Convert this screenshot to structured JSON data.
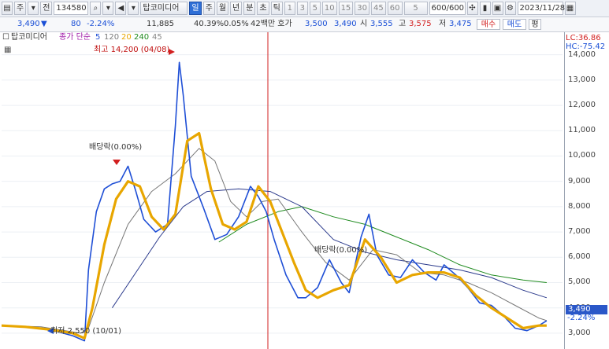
{
  "toolbar": {
    "market": "주",
    "pre": "전",
    "code": "134580",
    "name": "탑코미디어",
    "periods": [
      "일",
      "주",
      "월",
      "년",
      "분",
      "초",
      "틱"
    ],
    "active_period": "일",
    "numbers": [
      "1",
      "3",
      "5",
      "10",
      "15",
      "30",
      "45",
      "60"
    ],
    "interval": "5",
    "count": "600/600",
    "date": "2023/11/28"
  },
  "quote": {
    "price": "3,490",
    "change_arrow": "▼",
    "change": "80",
    "change_pct": "-2.24%",
    "volume": "11,885",
    "volume_ratio": "40.39%",
    "turnover": "0.05%",
    "quote_label": "42백만 호가",
    "ask": "3,500",
    "bid": "3,490",
    "open_label": "시",
    "open": "3,555",
    "high_label": "고",
    "high": "3,575",
    "low_label": "저",
    "low": "3,475",
    "buy_label": "매수",
    "sell_label": "매도",
    "avg_label": "평"
  },
  "legend": {
    "name": "탑코미디어",
    "ma_label": "종가 단순",
    "ma_periods": [
      "5",
      "120",
      "20",
      "240",
      "45"
    ],
    "ma_colors": [
      "#1f4fd6",
      "#7a7a7a",
      "#e8a600",
      "#1e8a1e",
      "#888888"
    ]
  },
  "axis": {
    "lc": "LC:36.86",
    "hc": "HC:-75.42",
    "ticks": [
      "14,000",
      "13,000",
      "12,000",
      "11,000",
      "10,000",
      "9,000",
      "8,000",
      "7,000",
      "6,000",
      "5,000",
      "4,000",
      "3,000"
    ],
    "current_price": "3,490",
    "current_change": "-2.24%"
  },
  "annotations": {
    "high": "최고 14,200 (04/08)",
    "low": "최저 2,550 (10/01)",
    "dividend1": "배당락(0.00%)",
    "dividend2": "배당락(0.00%)"
  },
  "chart_data": {
    "type": "line",
    "series": [
      {
        "name": "5",
        "color": "#1f4fd6",
        "x": [
          0,
          30,
          60,
          90,
          105,
          110,
          120,
          130,
          140,
          150,
          160,
          170,
          180,
          195,
          210,
          220,
          225,
          230,
          240,
          255,
          270,
          285,
          300,
          315,
          325,
          335,
          345,
          360,
          375,
          385,
          400,
          415,
          430,
          440,
          455,
          465,
          475,
          490,
          505,
          520,
          535,
          550,
          560,
          575,
          590,
          605,
          620,
          635,
          650,
          665,
          680,
          690
        ],
        "y": [
          3300,
          3250,
          3150,
          2900,
          2700,
          5500,
          7800,
          8700,
          8900,
          9000,
          9600,
          8600,
          7500,
          7000,
          7300,
          11200,
          13700,
          12400,
          9200,
          8000,
          6700,
          6900,
          7600,
          8800,
          8400,
          7800,
          6700,
          5300,
          4400,
          4400,
          4800,
          5900,
          5000,
          4600,
          6800,
          7700,
          6100,
          5300,
          5200,
          5900,
          5400,
          5100,
          5700,
          5300,
          4800,
          4200,
          4100,
          3700,
          3200,
          3100,
          3300,
          3490
        ]
      },
      {
        "name": "20",
        "color": "#e8a600",
        "x": [
          0,
          30,
          60,
          90,
          105,
          115,
          130,
          145,
          160,
          175,
          190,
          205,
          220,
          235,
          250,
          265,
          280,
          295,
          310,
          325,
          340,
          355,
          370,
          385,
          400,
          420,
          440,
          460,
          480,
          500,
          520,
          540,
          560,
          580,
          600,
          620,
          640,
          660,
          680,
          690
        ],
        "y": [
          3300,
          3250,
          3150,
          3000,
          2800,
          4000,
          6500,
          8300,
          9000,
          8800,
          7600,
          7100,
          7700,
          10600,
          10900,
          8700,
          7300,
          7100,
          7400,
          8800,
          8200,
          7000,
          5800,
          4700,
          4400,
          4700,
          4900,
          6700,
          6000,
          5000,
          5300,
          5400,
          5400,
          5200,
          4500,
          4000,
          3600,
          3200,
          3300,
          3300
        ]
      },
      {
        "name": "45",
        "color": "#777777",
        "x": [
          0,
          50,
          100,
          110,
          130,
          160,
          190,
          220,
          250,
          270,
          290,
          310,
          330,
          350,
          380,
          410,
          440,
          470,
          500,
          530,
          560,
          590,
          620,
          650,
          680,
          690
        ],
        "y": [
          3300,
          3250,
          3000,
          3200,
          5000,
          7300,
          8600,
          9300,
          10300,
          9800,
          8200,
          7600,
          8200,
          8300,
          7000,
          5800,
          5100,
          6300,
          6100,
          5400,
          5300,
          5000,
          4600,
          4100,
          3600,
          3500
        ]
      },
      {
        "name": "120",
        "color": "#2b3a8c",
        "x": [
          140,
          170,
          200,
          230,
          260,
          300,
          340,
          380,
          420,
          460,
          500,
          540,
          580,
          620,
          660,
          690
        ],
        "y": [
          4000,
          5400,
          6800,
          8000,
          8600,
          8700,
          8600,
          8000,
          6700,
          6200,
          5900,
          5700,
          5500,
          5200,
          4700,
          4400
        ]
      },
      {
        "name": "240",
        "color": "#1e8a1e",
        "x": [
          275,
          310,
          350,
          380,
          420,
          460,
          500,
          540,
          580,
          620,
          660,
          690
        ],
        "y": [
          6600,
          7300,
          7800,
          8000,
          7600,
          7300,
          6800,
          6300,
          5700,
          5300,
          5100,
          5000
        ]
      }
    ],
    "ylim": [
      2500,
      14300
    ],
    "grid": true
  }
}
